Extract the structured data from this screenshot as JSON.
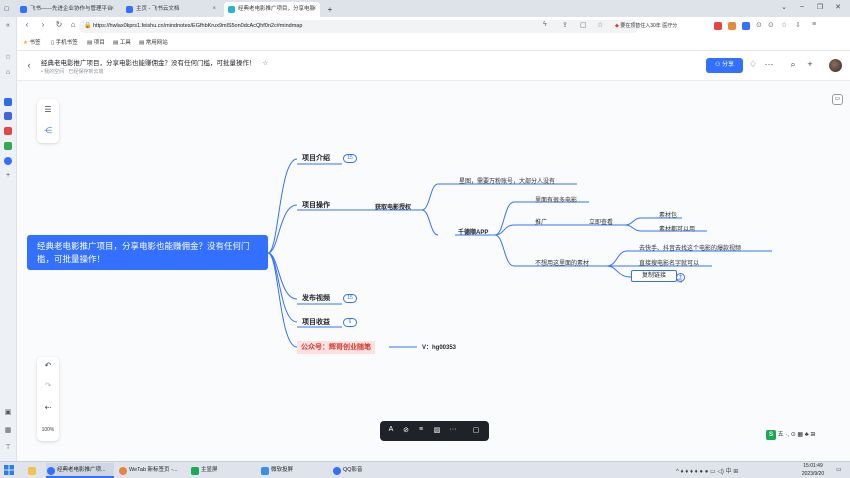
{
  "browser": {
    "tabs": [
      {
        "label": "飞书——先进企业协作与管理平台",
        "active": false
      },
      {
        "label": "主页 - 飞书云文档",
        "active": false
      },
      {
        "label": "经典老电影推广项目，分享电影",
        "active": true
      }
    ],
    "new_tab": "+",
    "url": "https://hwlax0kprs1.feishu.cn/mindnotes/EGfhbKrux9mlS5on0dcAcQhf0n2c#mindmap",
    "news_chip": "要在顶替住入30年 医疗分",
    "bookmarks": [
      "书签",
      "手机书签",
      "项目",
      "工具",
      "常用网站"
    ]
  },
  "doc": {
    "title": "经典老电影推广项目，分享电影也能赚佣金？没有任何门槛，可批量操作！",
    "subtitle_space": "我的空间",
    "subtitle_status": "已经保存到云端",
    "share_label": "分享"
  },
  "mindmap": {
    "root": "经典老电影推广项目，分享电影也能赚佣金？没有任何门槛，可批量操作！",
    "branches": {
      "intro": {
        "label": "项目介绍",
        "badge": "15"
      },
      "ops": {
        "label": "项目操作"
      },
      "publish": {
        "label": "发布视频",
        "badge": "15"
      },
      "income": {
        "label": "项目收益",
        "badge": "6"
      },
      "gzh": {
        "label": "公众号：辉哥创业随笔"
      }
    },
    "ops_child": "获取电影授权",
    "auth_children": {
      "xingtu": "星图，需要万粉账号，大部分人没有",
      "qianfan": "千德顺APP"
    },
    "qianfan_children": {
      "movies": "里面有很多电影",
      "promote": "推广",
      "notwant": "不想用这里面的素材"
    },
    "promote_child": "立即查看",
    "view_children": [
      "素材包",
      "素材都可以用"
    ],
    "notwant_children": [
      "去快手、抖音去找这个电影的爆款视频",
      "直接搜电影名字就可以",
      "复制链接"
    ],
    "gzh_child": "V：hg00353",
    "zoom": "100%"
  },
  "taskbar": {
    "items": [
      "经典老电影推广项...",
      "WeTab 新标签页 -...",
      "主显屏",
      "微软投屏",
      "QQ影音"
    ],
    "time": "15:01:49",
    "date": "2023/9/20",
    "ime": "五"
  },
  "colors": {
    "accent": "#3370ff",
    "highlight_bg": "#fde2e2",
    "highlight_text": "#d83931"
  }
}
